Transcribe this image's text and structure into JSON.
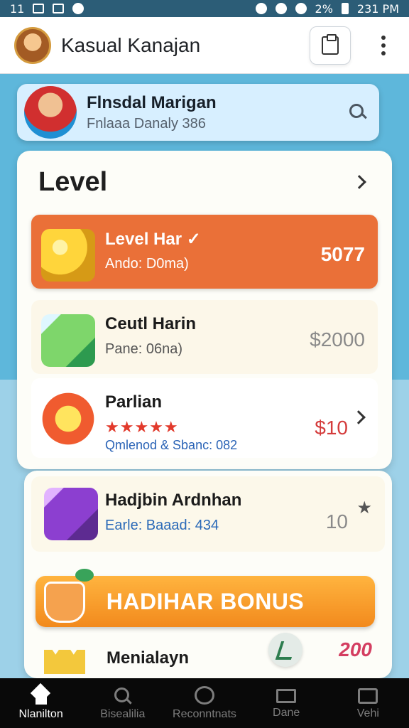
{
  "status": {
    "time_left": "11",
    "battery": "2%",
    "time_right": "231 PM"
  },
  "header": {
    "title": "Kasual Kanajan"
  },
  "profile": {
    "name": "Flnsdal Marigan",
    "subtitle": "Fnlaaa Danaly 386"
  },
  "panel": {
    "title": "Level"
  },
  "rows": [
    {
      "title": "Level Har ✓",
      "subtitle": "Ando: D0ma)",
      "value": "5077"
    },
    {
      "title": "Ceutl Harin",
      "subtitle": "Pane: 06na)",
      "value": "$2000"
    },
    {
      "title": "Parlian",
      "rating": "★★★★★",
      "subtitle": "Qmlenod & Sbanc: 082",
      "value": "$10"
    }
  ],
  "second_panel": {
    "title": "Hadjbin Ardnhan",
    "subtitle": "Earle: Baaad: 434",
    "value": "10",
    "bonus": "HADIHAR BONUS",
    "bottom_title": "Menialayn",
    "bottom_badge": "200"
  },
  "nav": {
    "home": "Nlanilton",
    "search": "Bisealilia",
    "recommendations": "Reconntnats",
    "dane": "Dane",
    "vehi": "Vehi"
  },
  "colors": {
    "status_bar": "#2c5d77",
    "accent_orange": "#ea7038",
    "bonus_orange": "#f28a1d",
    "sky_blue": "#5eb7db"
  },
  "icons": {
    "header_action": "clipboard-icon",
    "search": "search-icon",
    "menu": "more-vertical-icon"
  }
}
